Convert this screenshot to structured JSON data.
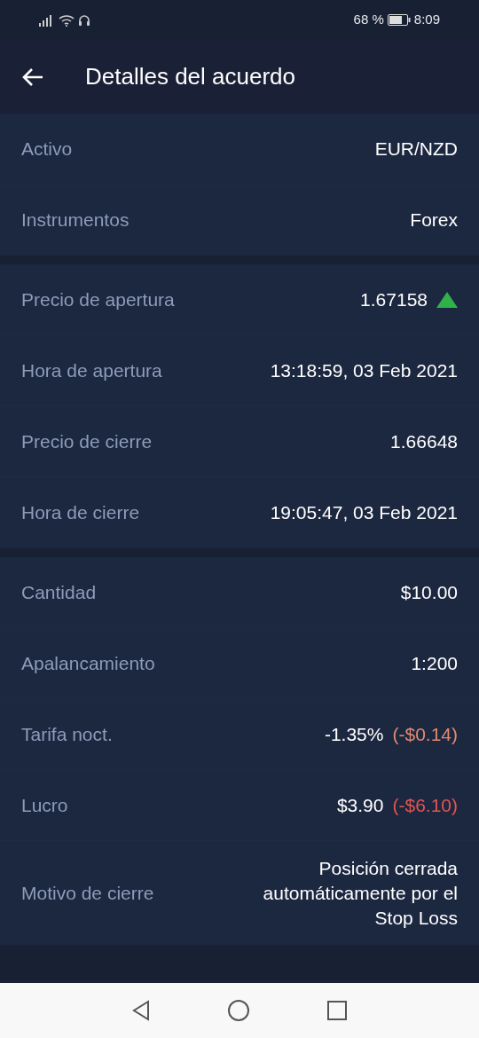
{
  "status_bar": {
    "battery_text": "68 %",
    "time": "8:09"
  },
  "header": {
    "title": "Detalles del acuerdo"
  },
  "groups": [
    {
      "rows": [
        {
          "label": "Activo",
          "value": "EUR/NZD"
        },
        {
          "label": "Instrumentos",
          "value": "Forex"
        }
      ]
    },
    {
      "rows": [
        {
          "label": "Precio de apertura",
          "value": "1.67158",
          "rising": true
        },
        {
          "label": "Hora de apertura",
          "value": "13:18:59, 03 Feb 2021"
        },
        {
          "label": "Precio de cierre",
          "value": "1.66648"
        },
        {
          "label": "Hora de cierre",
          "value": "19:05:47, 03 Feb 2021"
        }
      ]
    },
    {
      "rows": [
        {
          "label": "Cantidad",
          "value": "$10.00"
        },
        {
          "label": "Apalancamiento",
          "value": "1:200"
        },
        {
          "label": "Tarifa noct.",
          "value": "-1.35%",
          "extra": {
            "text": "(-$0.14)",
            "color": "#e08a70"
          }
        },
        {
          "label": "Lucro",
          "value": "$3.90",
          "extra": {
            "text": "(-$6.10)",
            "color": "#e05552"
          }
        },
        {
          "label": "Motivo de cierre",
          "value": "Posición cerrada automáticamente por el Stop Loss"
        }
      ]
    }
  ]
}
